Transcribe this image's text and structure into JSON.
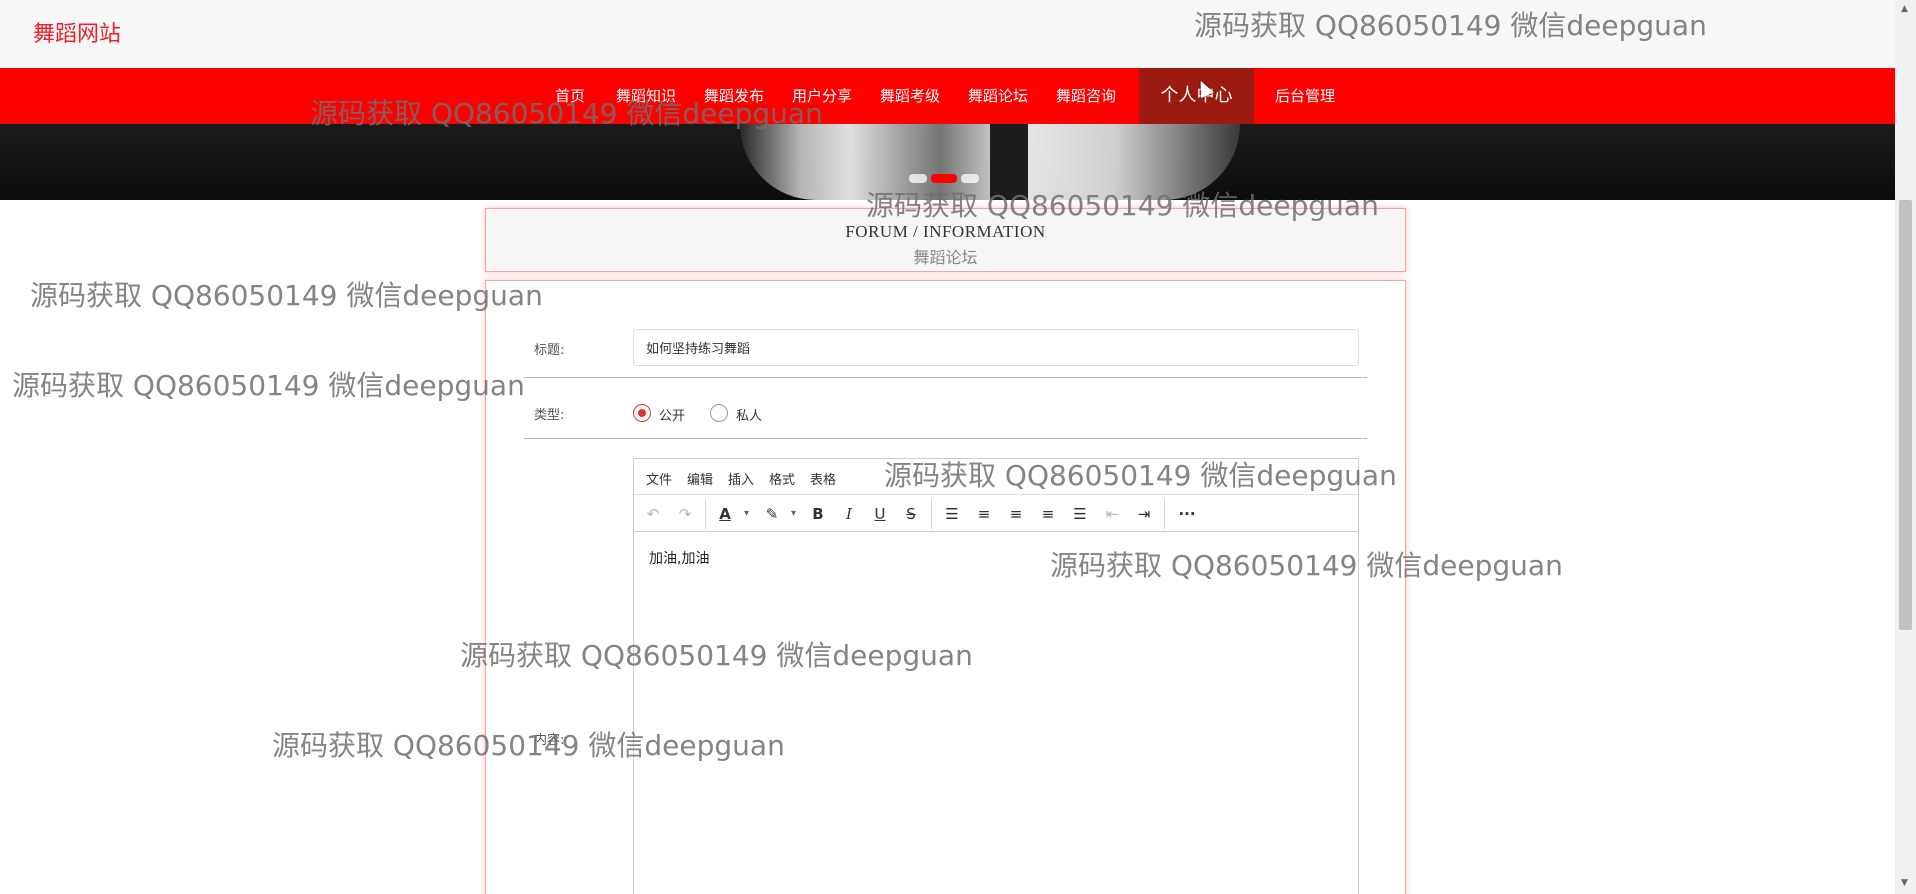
{
  "site": {
    "logo": "舞蹈网站"
  },
  "nav": {
    "items": [
      {
        "label": "首页"
      },
      {
        "label": "舞蹈知识"
      },
      {
        "label": "舞蹈发布"
      },
      {
        "label": "用户分享"
      },
      {
        "label": "舞蹈考级"
      },
      {
        "label": "舞蹈论坛"
      },
      {
        "label": "舞蹈咨询"
      },
      {
        "label": "个人中心",
        "active": true
      },
      {
        "label": "后台管理"
      }
    ]
  },
  "carousel": {
    "slides": 3,
    "active_index": 1
  },
  "section": {
    "title_en": "FORUM / INFORMATION",
    "title_cn": "舞蹈论坛"
  },
  "form": {
    "title_label": "标题:",
    "title_value": "如何坚持练习舞蹈",
    "type_label": "类型:",
    "type_options": [
      {
        "label": "公开",
        "checked": true
      },
      {
        "label": "私人",
        "checked": false
      }
    ],
    "content_label": "内容:"
  },
  "editor": {
    "menu": [
      "文件",
      "编辑",
      "插入",
      "格式",
      "表格"
    ],
    "toolbar_icons": [
      "undo-icon",
      "redo-icon",
      "text-color-icon",
      "highlight-icon",
      "bold-icon",
      "italic-icon",
      "underline-icon",
      "strikethrough-icon",
      "bullet-list-icon",
      "align-left-icon",
      "align-center-icon",
      "align-right-icon",
      "align-justify-icon",
      "outdent-icon",
      "indent-icon",
      "more-icon"
    ],
    "content": "加油,加油"
  },
  "watermark": "源码获取 QQ86050149 微信deepguan",
  "colors": {
    "brand_red": "#fe0000",
    "nav_active": "#9c1a10",
    "logo_red": "#e8202a"
  }
}
